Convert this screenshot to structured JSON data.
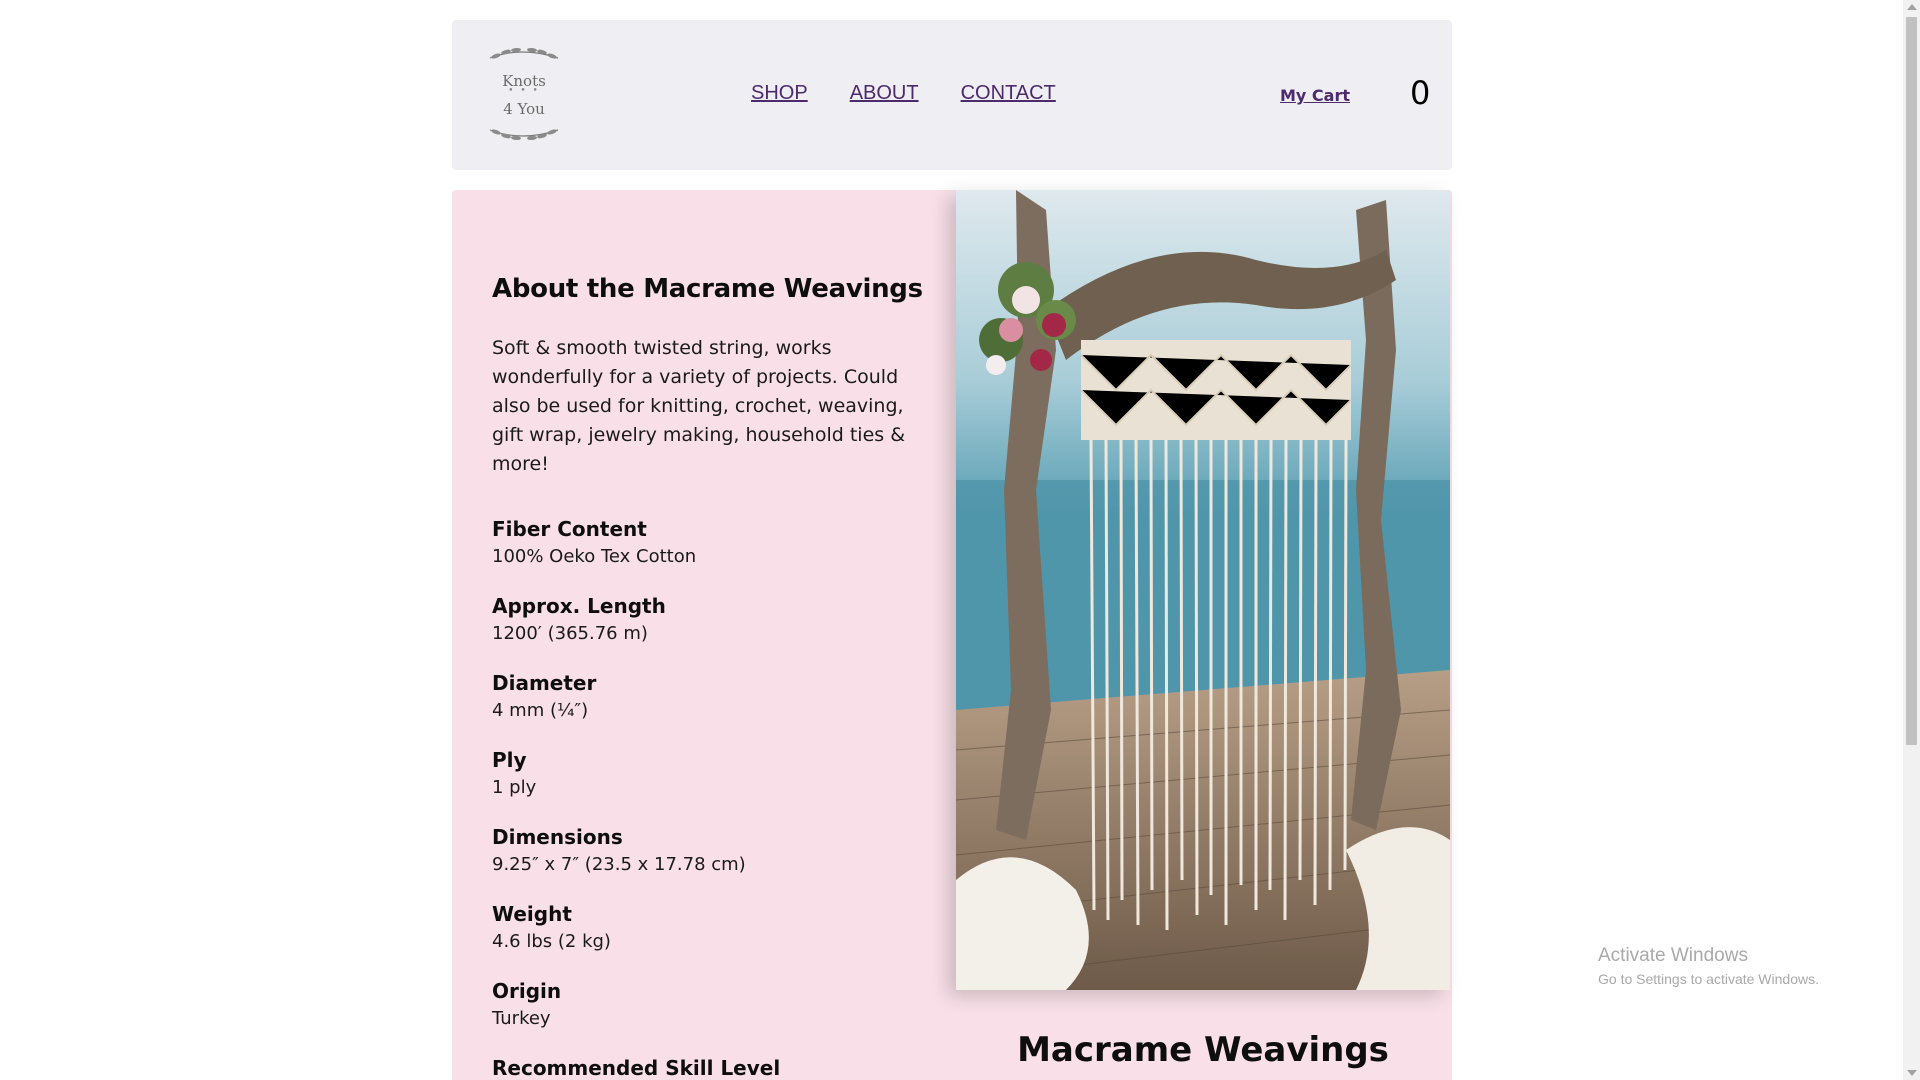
{
  "header": {
    "logo": {
      "line1": "Knots",
      "dots": "• • •",
      "line2": "4 You"
    },
    "nav": [
      {
        "label": "SHOP"
      },
      {
        "label": "ABOUT"
      },
      {
        "label": "CONTACT"
      }
    ],
    "cart_label": "My Cart",
    "cart_count": "0"
  },
  "about": {
    "title": "About the Macrame Weavings",
    "description": "Soft & smooth twisted string, works wonderfully for a variety of projects. Could also be used for knitting, crochet, weaving, gift wrap, jewelry making, household ties & more!",
    "specs": [
      {
        "label": "Fiber Content",
        "value": "100% Oeko Tex Cotton"
      },
      {
        "label": "Approx. Length",
        "value": "1200′ (365.76 m)"
      },
      {
        "label": "Diameter",
        "value": "4 mm (¼″)"
      },
      {
        "label": "Ply",
        "value": "1 ply"
      },
      {
        "label": "Dimensions",
        "value": "9.25″ x 7″ (23.5 x 17.78 cm)"
      },
      {
        "label": "Weight",
        "value": "4.6 lbs (2 kg)"
      },
      {
        "label": "Origin",
        "value": "Turkey"
      },
      {
        "label": "Recommended Skill Level",
        "value": ""
      }
    ]
  },
  "product": {
    "name": "Macrame Weavings"
  },
  "watermark": {
    "title": "Activate Windows",
    "subtitle": "Go to Settings to activate Windows."
  },
  "colors": {
    "panel": "#f9e0e8",
    "header": "#efeef2",
    "link": "#4c2a6b"
  }
}
